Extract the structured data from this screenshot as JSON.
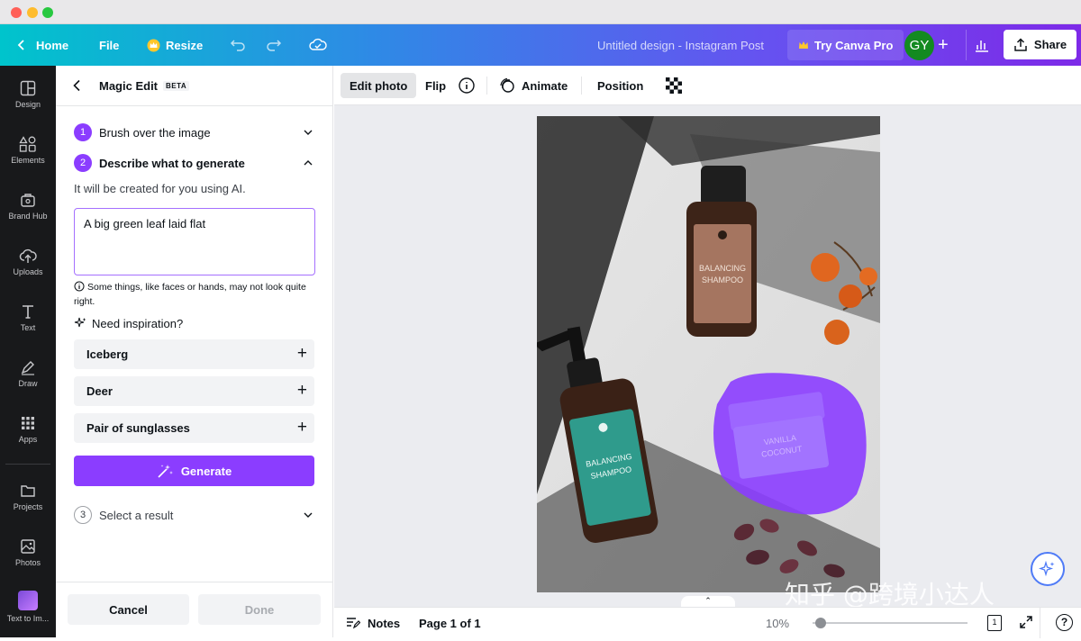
{
  "topbar": {
    "home": "Home",
    "file": "File",
    "resize": "Resize",
    "doc_title": "Untitled design - Instagram Post",
    "try_pro": "Try Canva Pro",
    "avatar": "GY",
    "share": "Share"
  },
  "rail": {
    "items": [
      {
        "label": "Design",
        "icon": "layout-icon"
      },
      {
        "label": "Elements",
        "icon": "shapes-icon"
      },
      {
        "label": "Brand Hub",
        "icon": "brand-icon"
      },
      {
        "label": "Uploads",
        "icon": "cloud-upload-icon"
      },
      {
        "label": "Text",
        "icon": "text-icon"
      },
      {
        "label": "Draw",
        "icon": "pen-icon"
      },
      {
        "label": "Apps",
        "icon": "grid-icon"
      },
      {
        "label": "Projects",
        "icon": "folder-icon"
      },
      {
        "label": "Photos",
        "icon": "image-icon"
      },
      {
        "label": "Text to Im...",
        "icon": "text-to-image-icon"
      }
    ]
  },
  "panel": {
    "title": "Magic Edit",
    "badge": "BETA",
    "step1": {
      "num": "1",
      "label": "Brush over the image"
    },
    "step2": {
      "num": "2",
      "label": "Describe what to generate"
    },
    "hint": "It will be created for you using AI.",
    "prompt_value": "A big green leaf laid flat",
    "note": "Some things, like faces or hands, may not look quite right.",
    "inspiration": "Need inspiration?",
    "suggestions": [
      "Iceberg",
      "Deer",
      "Pair of sunglasses"
    ],
    "generate": "Generate",
    "step3": {
      "num": "3",
      "label": "Select a result"
    },
    "cancel": "Cancel",
    "done": "Done"
  },
  "context_toolbar": {
    "edit_photo": "Edit photo",
    "flip": "Flip",
    "animate": "Animate",
    "position": "Position"
  },
  "canvas": {
    "bottle_brown": {
      "line1": "BALANCING",
      "line2": "SHAMPOO"
    },
    "bottle_teal": {
      "line1": "BALANCING",
      "line2": "SHAMPOO"
    },
    "jar": {
      "line1": "VANILLA",
      "line2": "COCONUT"
    },
    "watermark": "知乎 @跨境小达人"
  },
  "footer": {
    "notes": "Notes",
    "page": "Page 1 of 1",
    "zoom": "10%",
    "page_count": "1",
    "zoom_level": 0.05
  },
  "colors": {
    "accent": "#8b3dff",
    "mask": "#8b3dff",
    "brand_teal": "#00c4cc"
  }
}
